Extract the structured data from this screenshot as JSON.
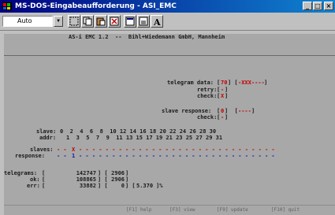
{
  "window": {
    "title": "MS-DOS-Eingabeaufforderung - ASI_EMC",
    "minimize": "_",
    "maximize": "□",
    "close": "×"
  },
  "toolbar": {
    "font_size": "Auto"
  },
  "console": {
    "header": "AS-i EMC 1.2  --  Bihl+Wiedemann GmbH, Mannheim",
    "telegram_data_label": "telegram data:",
    "telegram_data_value": "70",
    "telegram_data_bits": "-XXX----",
    "retry_label": "retry:",
    "retry_value": "-",
    "check_label": "check:",
    "check_value": "X",
    "slave_response_label": "slave response:",
    "slave_response_value": "0",
    "slave_response_bits": "----",
    "check2_label": "check:",
    "check2_value": "-",
    "slave_label": "slave:",
    "slave_numbers": "0  2  4  6  8  10 12 14 16 18 20 22 24 26 28 30",
    "addr_label": "addr:",
    "addr_numbers": "1  3  5  7  9  11 13 15 17 19 21 23 25 27 29 31",
    "slaves_label": "slaves:",
    "slaves_row_prefix": "- -",
    "slaves_row_mark": "X",
    "slaves_row_rest": "- - - - - - - - - - - - - - - - - - - - - - - - - - - - - -",
    "response_label": "response:",
    "response_row_prefix": "- -",
    "response_row_mark": "1",
    "response_row_rest": "- - - - - - - - - - - - - - - - - - - - - - - - - - - - - -",
    "telegrams_label": "telegrams:",
    "telegrams_value": "142747",
    "telegrams_value2": "2906",
    "ok_label": "ok:",
    "ok_value": "108865",
    "ok_value2": "2906",
    "err_label": "err:",
    "err_value": "33882",
    "err_value2": "0",
    "err_percent": "5.370",
    "f1": "[F1] help",
    "f3": "[F3] view",
    "f9": "[F9] update",
    "f10": "[F10] quit"
  }
}
